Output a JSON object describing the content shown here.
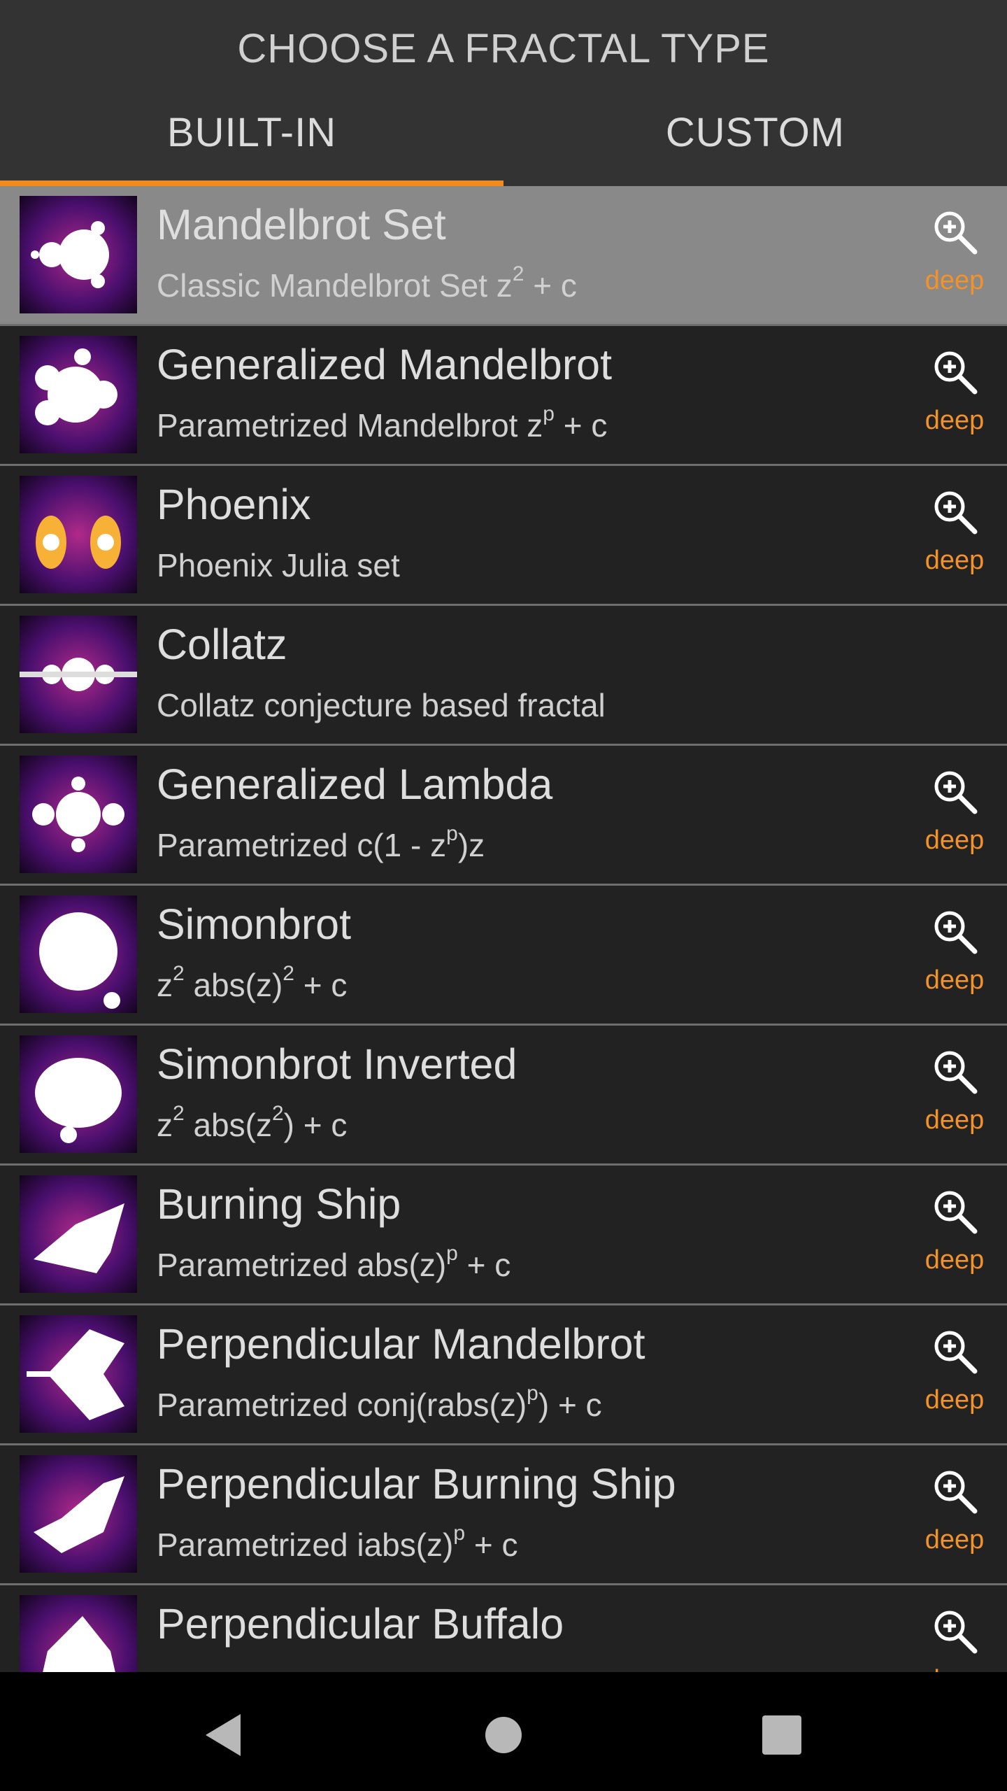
{
  "header": {
    "title": "CHOOSE A FRACTAL TYPE",
    "tabs": [
      {
        "label": "BUILT-IN",
        "active": true
      },
      {
        "label": "CUSTOM",
        "active": false
      }
    ],
    "accent_color": "#f08a1c"
  },
  "fractals": [
    {
      "title": "Mandelbrot Set",
      "sub_html": "Classic Mandelbrot Set z<sup>2</sup> + c",
      "zoom_icon": "zoom-in-icon",
      "deep_label": "deep",
      "selected": true
    },
    {
      "title": "Generalized Mandelbrot",
      "sub_html": "Parametrized Mandelbrot z<sup>p</sup> + c",
      "zoom_icon": "zoom-in-icon",
      "deep_label": "deep"
    },
    {
      "title": "Phoenix",
      "sub_html": "Phoenix Julia set",
      "zoom_icon": "zoom-in-icon",
      "deep_label": "deep"
    },
    {
      "title": "Collatz",
      "sub_html": "Collatz conjecture based fractal"
    },
    {
      "title": "Generalized Lambda",
      "sub_html": "Parametrized c(1 - z<sup>p</sup>)z",
      "zoom_icon": "zoom-in-icon",
      "deep_label": "deep"
    },
    {
      "title": "Simonbrot",
      "sub_html": "z<sup>2</sup> abs(z)<sup>2</sup> + c",
      "zoom_icon": "zoom-in-icon",
      "deep_label": "deep"
    },
    {
      "title": "Simonbrot Inverted",
      "sub_html": "z<sup>2</sup> abs(z<sup>2</sup>) + c",
      "zoom_icon": "zoom-in-icon",
      "deep_label": "deep"
    },
    {
      "title": "Burning Ship",
      "sub_html": "Parametrized abs(z)<sup>p</sup> + c",
      "zoom_icon": "zoom-in-icon",
      "deep_label": "deep"
    },
    {
      "title": "Perpendicular Mandelbrot",
      "sub_html": "Parametrized conj(rabs(z)<sup>p</sup>) + c",
      "zoom_icon": "zoom-in-icon",
      "deep_label": "deep"
    },
    {
      "title": "Perpendicular Burning Ship",
      "sub_html": "Parametrized iabs(z)<sup>p</sup> + c",
      "zoom_icon": "zoom-in-icon",
      "deep_label": "deep"
    },
    {
      "title": "Perpendicular Buffalo",
      "sub_html": "",
      "zoom_icon": "zoom-in-icon",
      "deep_label": "deep"
    }
  ],
  "navbar": {
    "back_icon": "back-triangle-icon",
    "home_icon": "home-circle-icon",
    "recents_icon": "recents-square-icon"
  }
}
